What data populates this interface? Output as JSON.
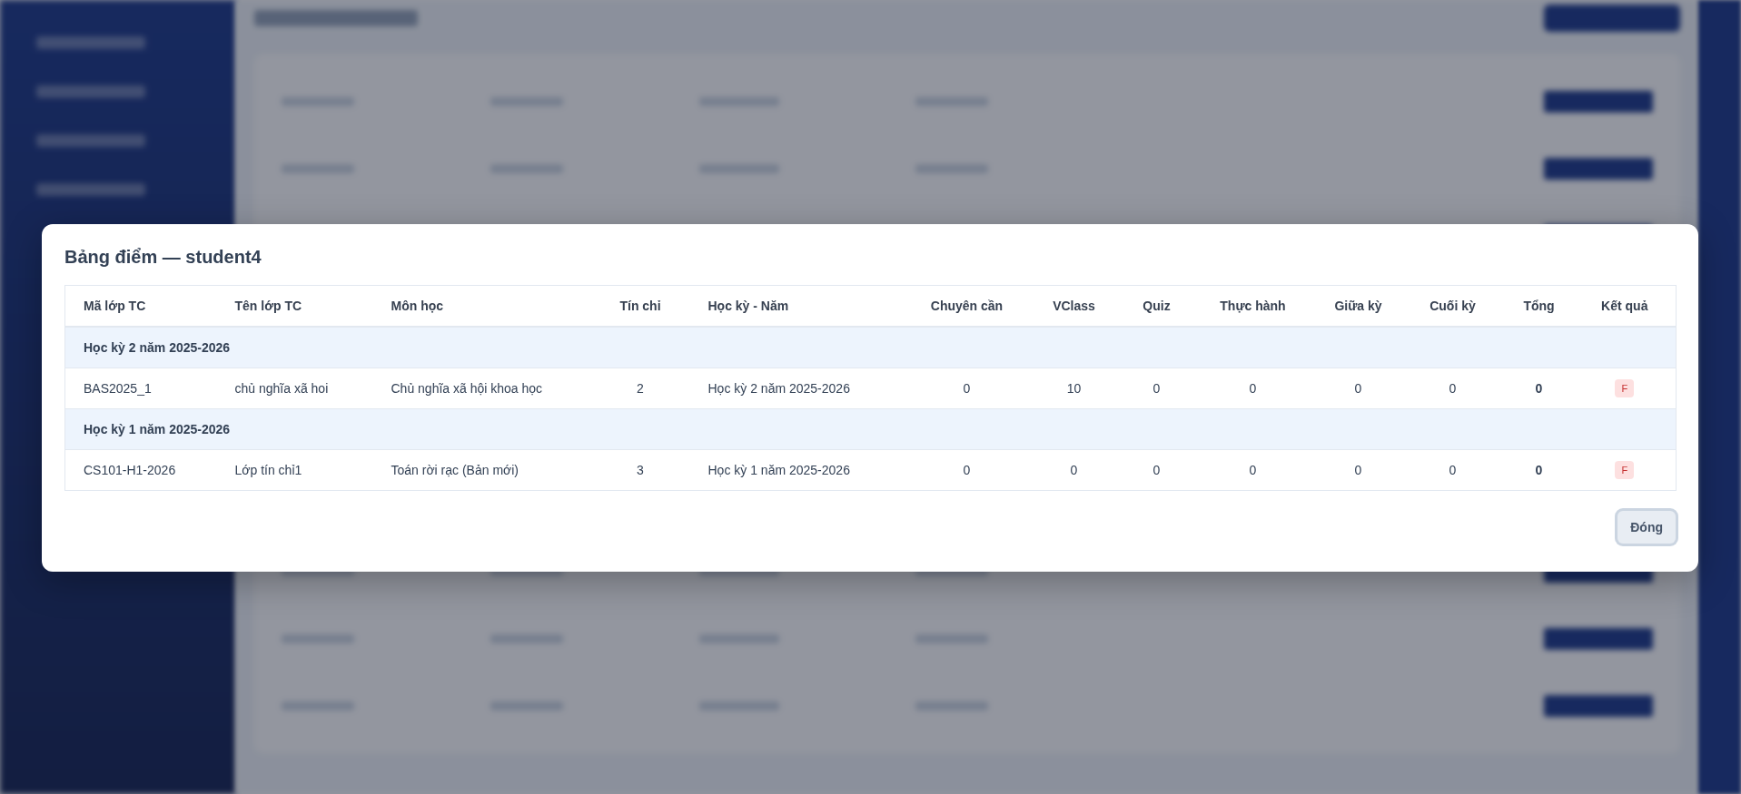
{
  "dialog": {
    "title": "Bảng điểm — student4",
    "table": {
      "columns": [
        {
          "label": "Mã lớp TC",
          "kind": "text"
        },
        {
          "label": "Tên lớp TC",
          "kind": "text"
        },
        {
          "label": "Môn học",
          "kind": "text"
        },
        {
          "label": "Tín chỉ",
          "kind": "number"
        },
        {
          "label": "Học kỳ - Năm",
          "kind": "text"
        },
        {
          "label": "Chuyên cần",
          "kind": "number"
        },
        {
          "label": "VClass",
          "kind": "number"
        },
        {
          "label": "Quiz",
          "kind": "number"
        },
        {
          "label": "Thực hành",
          "kind": "number"
        },
        {
          "label": "Giữa kỳ",
          "kind": "number"
        },
        {
          "label": "Cuối kỳ",
          "kind": "number"
        },
        {
          "label": "Tổng",
          "kind": "total"
        },
        {
          "label": "Kết quả",
          "kind": "badge"
        }
      ],
      "rows": [
        {
          "kind": "group",
          "label": "Học kỳ 2 năm 2025-2026"
        },
        {
          "kind": "course",
          "cells": [
            "BAS2025_1",
            "chủ nghĩa xã hoi",
            "Chủ nghĩa xã hội khoa học",
            "2",
            "Học kỳ 2 năm 2025-2026",
            "0",
            "10",
            "0",
            "0",
            "0",
            "0",
            "0",
            "F"
          ]
        },
        {
          "kind": "group",
          "label": "Học kỳ 1 năm 2025-2026"
        },
        {
          "kind": "course",
          "cells": [
            "CS101-H1-2026",
            "Lớp tín chỉ1",
            "Toán rời rạc (Bản mới)",
            "3",
            "Học kỳ 1 năm 2025-2026",
            "0",
            "0",
            "0",
            "0",
            "0",
            "0",
            "0",
            "F"
          ]
        }
      ]
    },
    "close_button": {
      "label": "Đóng",
      "focused": true
    }
  }
}
